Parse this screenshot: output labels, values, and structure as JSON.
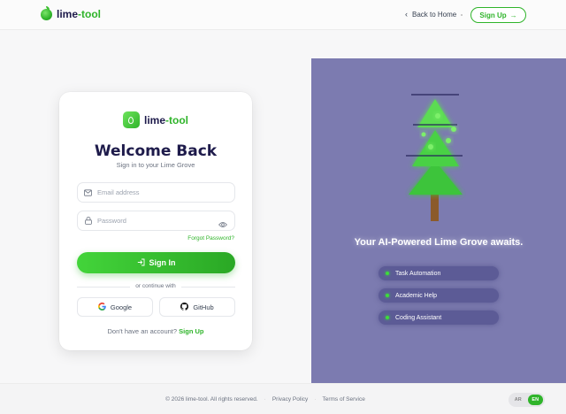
{
  "header": {
    "brand_left": "lime",
    "brand_right": "-tool",
    "back_label": "Back to Home",
    "signup_label": "Sign Up"
  },
  "hero": {
    "tagline": "Your AI-Powered Lime Grove awaits.",
    "features": [
      "Task Automation",
      "Academic Help",
      "Coding Assistant"
    ]
  },
  "login": {
    "brand_left": "lime",
    "brand_right": "-tool",
    "title": "Welcome Back",
    "subtitle": "Sign in to your Lime Grove",
    "email_placeholder": "Email address",
    "password_placeholder": "Password",
    "forgot_label": "Forgot Password?",
    "signin_label": "Sign In",
    "divider_label": "or continue with",
    "google_label": "Google",
    "github_label": "GitHub",
    "no_account_text": "Don't have an account?",
    "signup_link": "Sign Up"
  },
  "footer": {
    "copyright": "© 2026 lime-tool. All rights reserved.",
    "privacy": "Privacy Policy",
    "terms": "Terms of Service",
    "lang_options": [
      "AR",
      "EN"
    ],
    "lang_selected": "EN"
  },
  "colors": {
    "accent": "#2fb42a",
    "brand_dark": "#1e1b4b",
    "panel": "#7c7bb0"
  }
}
